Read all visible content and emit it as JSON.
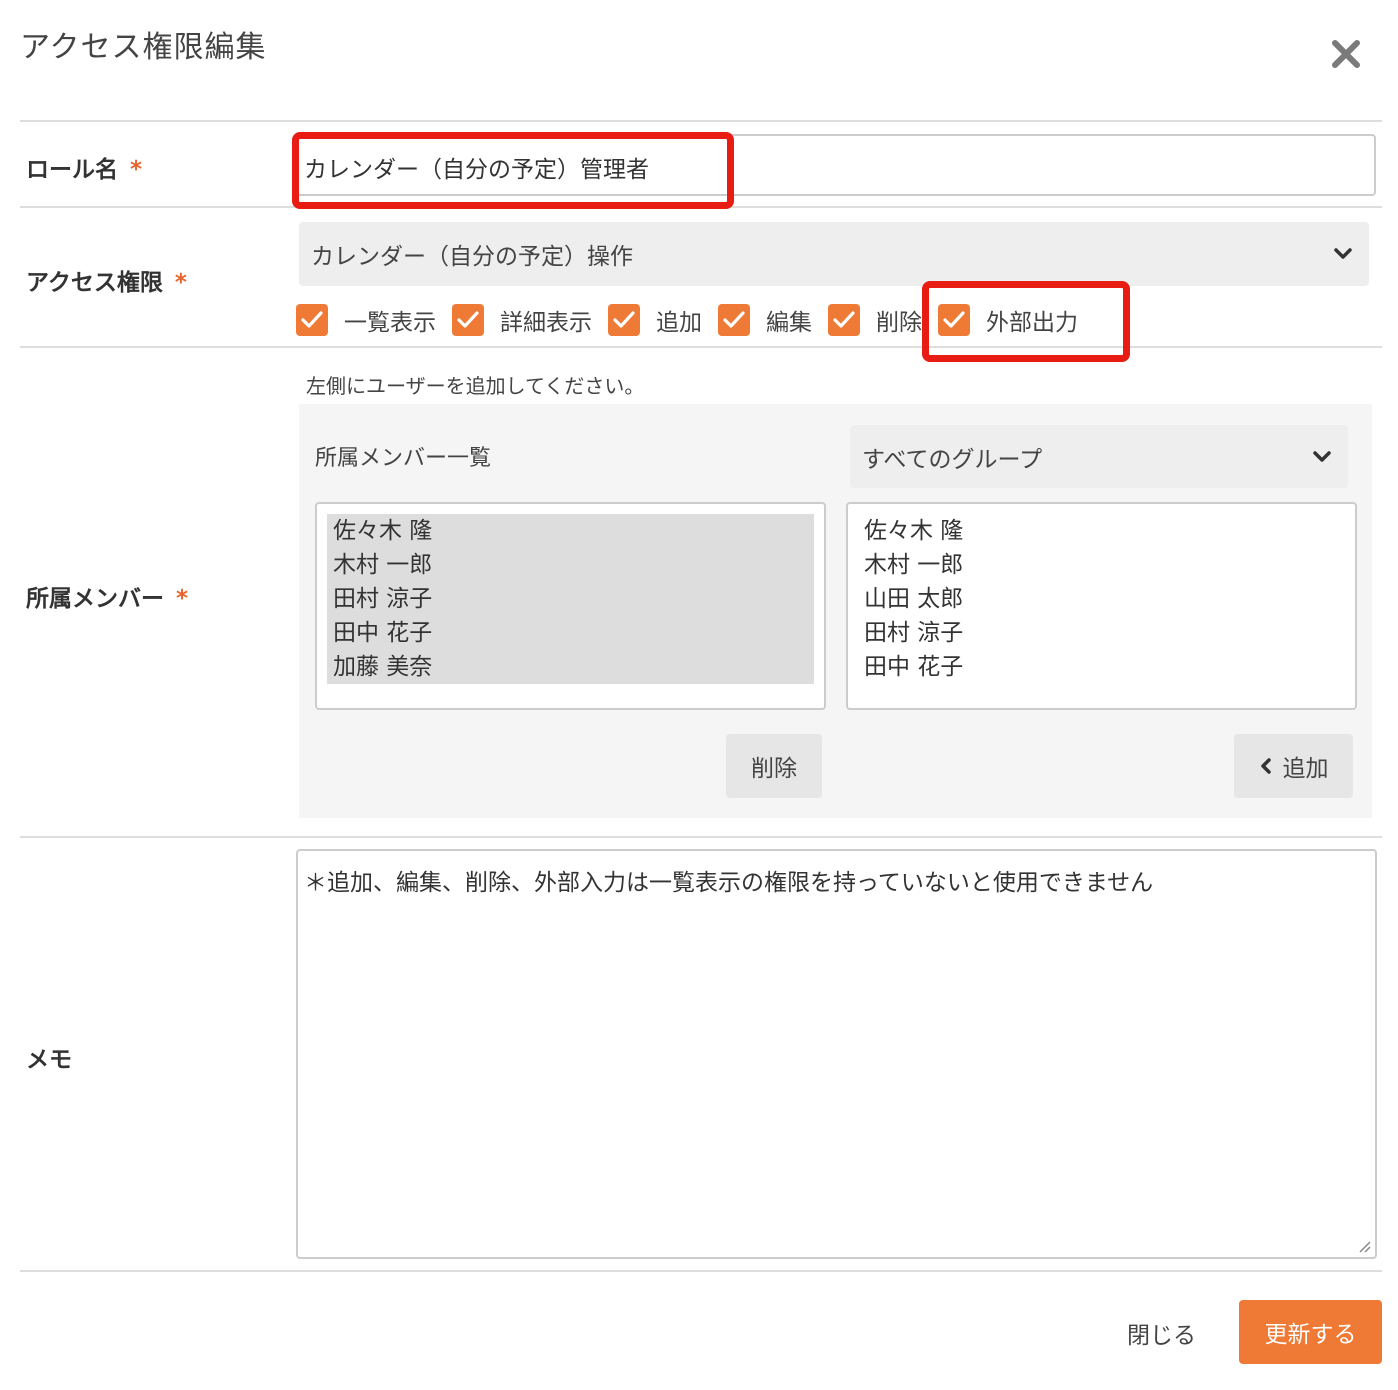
{
  "dialog": {
    "title": "アクセス権限編集",
    "close_icon": "close-icon"
  },
  "role_name": {
    "label": "ロール名",
    "required_mark": "*",
    "value": "カレンダー（自分の予定）管理者"
  },
  "access": {
    "label": "アクセス権限",
    "required_mark": "*",
    "selected": "カレンダー（自分の予定）操作",
    "permissions": [
      {
        "label": "一覧表示",
        "checked": true
      },
      {
        "label": "詳細表示",
        "checked": true
      },
      {
        "label": "追加",
        "checked": true
      },
      {
        "label": "編集",
        "checked": true
      },
      {
        "label": "削除",
        "checked": true
      },
      {
        "label": "外部出力",
        "checked": true
      }
    ]
  },
  "members": {
    "label": "所属メンバー",
    "required_mark": "*",
    "hint": "左側にユーザーを追加してください。",
    "list_title": "所属メンバー一覧",
    "group_select": "すべてのグループ",
    "assigned": [
      "佐々木 隆",
      "木村 一郎",
      "田村 涼子",
      "田中 花子",
      "加藤 美奈"
    ],
    "available": [
      "佐々木 隆",
      "木村 一郎",
      "山田 太郎",
      "田村 涼子",
      "田中 花子"
    ],
    "delete_button": "削除",
    "add_button": "追加"
  },
  "memo": {
    "label": "メモ",
    "value": "＊追加、編集、削除、外部入力は一覧表示の権限を持っていないと使用できません"
  },
  "footer": {
    "close_label": "閉じる",
    "update_label": "更新する"
  },
  "colors": {
    "accent": "#ee7a36",
    "highlight": "#e81c13"
  }
}
